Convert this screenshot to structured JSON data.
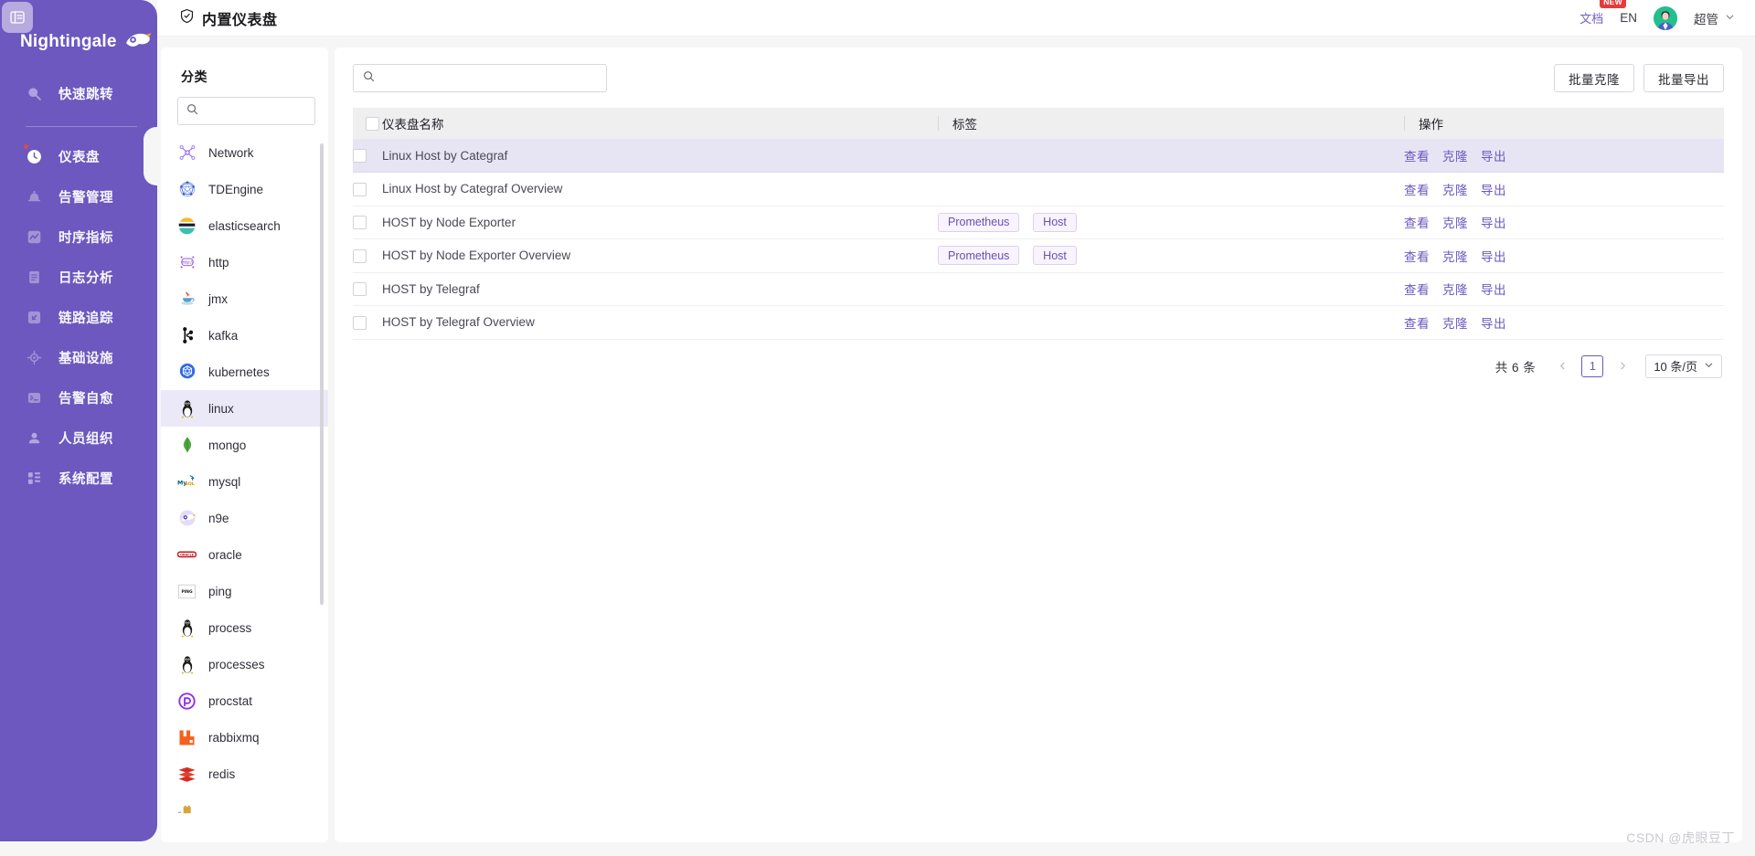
{
  "brand": {
    "name": "Nightingale",
    "logo_icon": "bird-logo-icon"
  },
  "sidebar": {
    "collapse_icon": "sidebar-collapse-icon",
    "quick": {
      "label": "快速跳转",
      "icon": "search-icon"
    },
    "items": [
      {
        "label": "仪表盘",
        "icon": "dashboard-icon",
        "active": true
      },
      {
        "label": "告警管理",
        "icon": "bell-icon",
        "active": false
      },
      {
        "label": "时序指标",
        "icon": "chart-line-icon",
        "active": false
      },
      {
        "label": "日志分析",
        "icon": "document-icon",
        "active": false
      },
      {
        "label": "链路追踪",
        "icon": "link-icon",
        "active": false
      },
      {
        "label": "基础设施",
        "icon": "target-icon",
        "active": false
      },
      {
        "label": "告警自愈",
        "icon": "terminal-icon",
        "active": false
      },
      {
        "label": "人员组织",
        "icon": "user-icon",
        "active": false
      },
      {
        "label": "系统配置",
        "icon": "grid-icon",
        "active": false
      }
    ]
  },
  "header": {
    "title": "内置仪表盘",
    "title_icon": "shield-check-icon",
    "doc_label": "文档",
    "doc_badge": "NEW",
    "lang_label": "EN",
    "user_name": "超管",
    "avatar_icon": "user-avatar",
    "caret_icon": "chevron-down-icon"
  },
  "categories": {
    "title": "分类",
    "search": {
      "value": "",
      "placeholder": "",
      "icon": "search-icon"
    },
    "items": [
      {
        "label": "Network",
        "icon": "network-icon",
        "active": false
      },
      {
        "label": "TDEngine",
        "icon": "tdengine-icon",
        "active": false
      },
      {
        "label": "elasticsearch",
        "icon": "elasticsearch-icon",
        "active": false
      },
      {
        "label": "http",
        "icon": "http-icon",
        "active": false
      },
      {
        "label": "jmx",
        "icon": "java-icon",
        "active": false
      },
      {
        "label": "kafka",
        "icon": "kafka-icon",
        "active": false
      },
      {
        "label": "kubernetes",
        "icon": "kubernetes-icon",
        "active": false
      },
      {
        "label": "linux",
        "icon": "linux-tux-icon",
        "active": true
      },
      {
        "label": "mongo",
        "icon": "mongodb-icon",
        "active": false
      },
      {
        "label": "mysql",
        "icon": "mysql-icon",
        "active": false
      },
      {
        "label": "n9e",
        "icon": "n9e-icon",
        "active": false
      },
      {
        "label": "oracle",
        "icon": "oracle-icon",
        "active": false
      },
      {
        "label": "ping",
        "icon": "ping-icon",
        "active": false
      },
      {
        "label": "process",
        "icon": "linux-tux-icon",
        "active": false
      },
      {
        "label": "processes",
        "icon": "linux-tux-icon",
        "active": false
      },
      {
        "label": "procstat",
        "icon": "procstat-icon",
        "active": false
      },
      {
        "label": "rabbixmq",
        "icon": "rabbitmq-icon",
        "active": false
      },
      {
        "label": "redis",
        "icon": "redis-icon",
        "active": false
      },
      {
        "label": "",
        "icon": "partial-icon",
        "active": false
      }
    ]
  },
  "toolbar": {
    "search": {
      "value": "",
      "placeholder": "",
      "icon": "search-icon"
    },
    "batch_clone_label": "批量克隆",
    "batch_export_label": "批量导出"
  },
  "table": {
    "columns": [
      "仪表盘名称",
      "标签",
      "操作"
    ],
    "actions": [
      "查看",
      "克隆",
      "导出"
    ],
    "rows": [
      {
        "name": "Linux Host by Categraf",
        "tags": [],
        "highlighted": true
      },
      {
        "name": "Linux Host by Categraf Overview",
        "tags": [],
        "highlighted": false
      },
      {
        "name": "HOST by Node Exporter",
        "tags": [
          "Prometheus",
          "Host"
        ],
        "highlighted": false
      },
      {
        "name": "HOST by Node Exporter Overview",
        "tags": [
          "Prometheus",
          "Host"
        ],
        "highlighted": false
      },
      {
        "name": "HOST by Telegraf",
        "tags": [],
        "highlighted": false
      },
      {
        "name": "HOST by Telegraf Overview",
        "tags": [],
        "highlighted": false
      }
    ]
  },
  "pagination": {
    "total_label": "共 6 条",
    "prev_icon": "chevron-left-icon",
    "next_icon": "chevron-right-icon",
    "current_page": "1",
    "page_size_label": "10 条/页",
    "page_size_caret": "chevron-down-icon"
  },
  "watermark": "CSDN @虎眼豆丁",
  "colors": {
    "brand_purple": "#6c58bf",
    "row_highlight": "#e7e5f3",
    "tag_text": "#6b4fb5",
    "badge_red": "#e63b3b"
  }
}
